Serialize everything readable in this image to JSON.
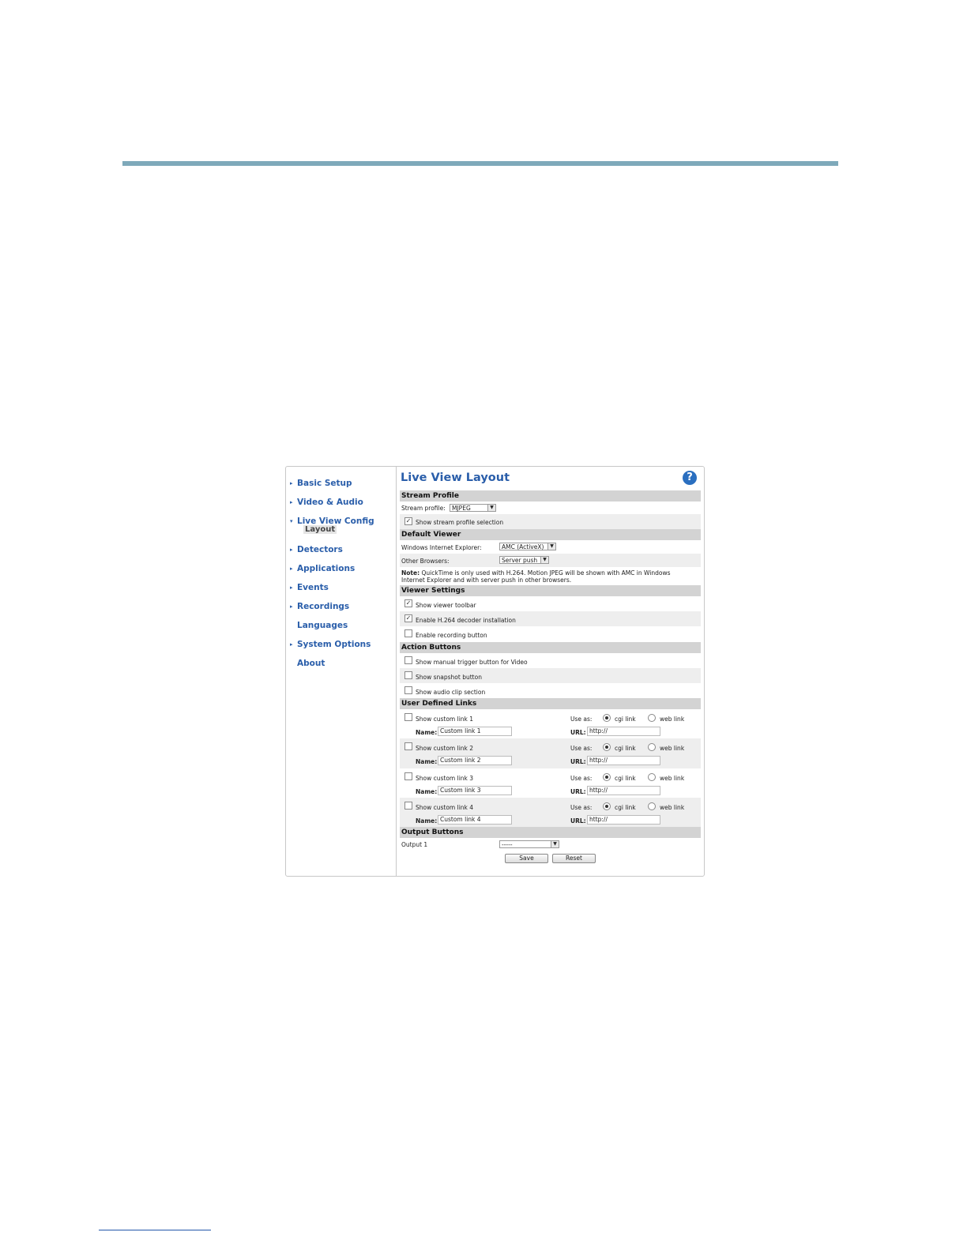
{
  "nav": {
    "items": [
      {
        "label": "Basic Setup",
        "arrow": "▸"
      },
      {
        "label": "Video & Audio",
        "arrow": "▸"
      },
      {
        "label": "Live View Config",
        "arrow": "▾"
      },
      {
        "label": "Detectors",
        "arrow": "▸"
      },
      {
        "label": "Applications",
        "arrow": "▸"
      },
      {
        "label": "Events",
        "arrow": "▸"
      },
      {
        "label": "Recordings",
        "arrow": "▸"
      },
      {
        "label": "Languages",
        "arrow": ""
      },
      {
        "label": "System Options",
        "arrow": "▸"
      },
      {
        "label": "About",
        "arrow": ""
      }
    ],
    "sub_item": "Layout"
  },
  "page": {
    "title": "Live View Layout",
    "help": "?"
  },
  "stream_profile": {
    "header": "Stream Profile",
    "label": "Stream profile:",
    "value": "MJPEG",
    "show_selection": "Show stream profile selection"
  },
  "default_viewer": {
    "header": "Default Viewer",
    "ie_label": "Windows Internet Explorer:",
    "ie_value": "AMC (ActiveX)",
    "other_label": "Other Browsers:",
    "other_value": "Server push",
    "note_bold": "Note:",
    "note_line1": "QuickTime is only used with H.264. Motion JPEG will be shown with AMC in Windows",
    "note_line2": "Internet Explorer and with server push in other browsers."
  },
  "viewer_settings": {
    "header": "Viewer Settings",
    "items": [
      "Show viewer toolbar",
      "Enable H.264 decoder installation",
      "Enable recording button"
    ]
  },
  "action_buttons": {
    "header": "Action Buttons",
    "items": [
      "Show manual trigger button for Video",
      "Show snapshot button",
      "Show audio clip section"
    ]
  },
  "user_links": {
    "header": "User Defined Links",
    "use_as": "Use as:",
    "cgi": "cgi link",
    "web": "web link",
    "name_label": "Name:",
    "url_label": "URL:",
    "links": [
      {
        "show": "Show custom link 1",
        "name": "Custom link 1",
        "url": "http://"
      },
      {
        "show": "Show custom link 2",
        "name": "Custom link 2",
        "url": "http://"
      },
      {
        "show": "Show custom link 3",
        "name": "Custom link 3",
        "url": "http://"
      },
      {
        "show": "Show custom link 4",
        "name": "Custom link 4",
        "url": "http://"
      }
    ]
  },
  "output_buttons": {
    "header": "Output Buttons",
    "label": "Output 1",
    "value": "-----"
  },
  "buttons": {
    "save": "Save",
    "reset": "Reset"
  },
  "colors": {
    "accent_rule": "#7ea9ba",
    "link_blue": "#2a5eaa",
    "section_gray": "#d3d3d3"
  }
}
